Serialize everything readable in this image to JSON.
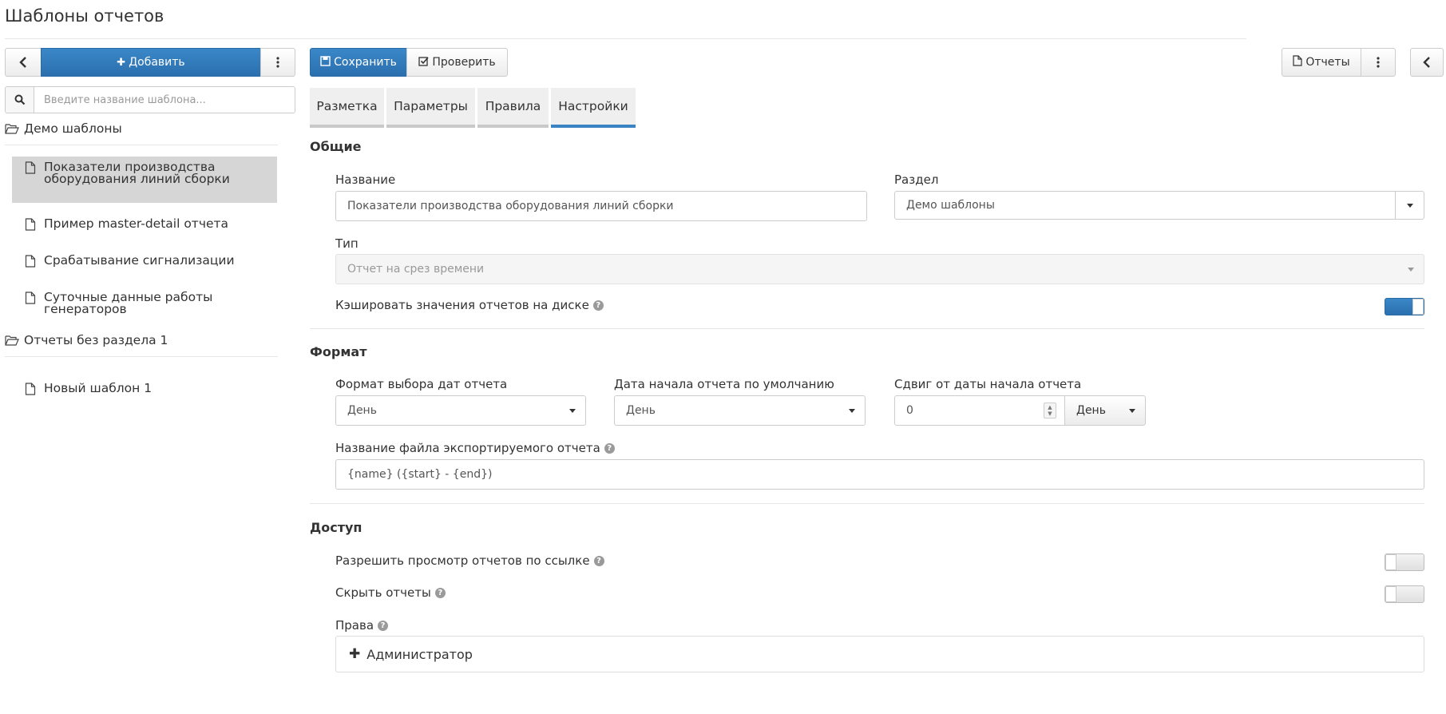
{
  "page": {
    "title": "Шаблоны отчетов"
  },
  "sidebar": {
    "add_label": "Добавить",
    "search_placeholder": "Введите название шаблона...",
    "folders": [
      {
        "name": "Демо шаблоны",
        "items": [
          {
            "line1": "Показатели производства",
            "line2": "оборудования линий сборки",
            "selected": true
          },
          {
            "line1": "Пример master-detail отчета",
            "line2": ""
          },
          {
            "line1": "Срабатывание сигнализации",
            "line2": ""
          },
          {
            "line1": "Суточные данные работы",
            "line2": "генераторов"
          }
        ]
      },
      {
        "name": "Отчеты без раздела 1",
        "items": [
          {
            "line1": "Новый шаблон 1",
            "line2": ""
          }
        ]
      }
    ]
  },
  "toolbar": {
    "save_label": "Сохранить",
    "check_label": "Проверить",
    "reports_label": "Отчеты"
  },
  "tabs": [
    {
      "label": "Разметка",
      "active": false
    },
    {
      "label": "Параметры",
      "active": false
    },
    {
      "label": "Правила",
      "active": false
    },
    {
      "label": "Настройки",
      "active": true
    }
  ],
  "general": {
    "title": "Общие",
    "name_label": "Название",
    "name_value": "Показатели производства оборудования линий сборки",
    "section_label": "Раздел",
    "section_value": "Демо шаблоны",
    "type_label": "Тип",
    "type_value": "Отчет на срез времени",
    "cache_label": "Кэшировать значения отчетов на диске",
    "cache_enabled": true
  },
  "format": {
    "title": "Формат",
    "date_format_label": "Формат выбора дат отчета",
    "date_format_value": "День",
    "default_start_label": "Дата начала отчета по умолчанию",
    "default_start_value": "День",
    "offset_label": "Сдвиг от даты начала отчета",
    "offset_value": "0",
    "offset_unit": "День",
    "filename_label": "Название файла экспортируемого отчета",
    "filename_value": "{name} ({start} - {end})"
  },
  "access": {
    "title": "Доступ",
    "link_view_label": "Разрешить просмотр отчетов по ссылке",
    "link_view_enabled": false,
    "hide_label": "Скрыть отчеты",
    "hide_enabled": false,
    "rights_label": "Права",
    "rights_item": "Администратор"
  },
  "icons": {
    "help": "question-circle-icon",
    "folder": "folder-open-icon",
    "file": "file-icon"
  },
  "colors": {
    "primary": "#2f7bbd",
    "active_tab": "#3b84c4"
  }
}
